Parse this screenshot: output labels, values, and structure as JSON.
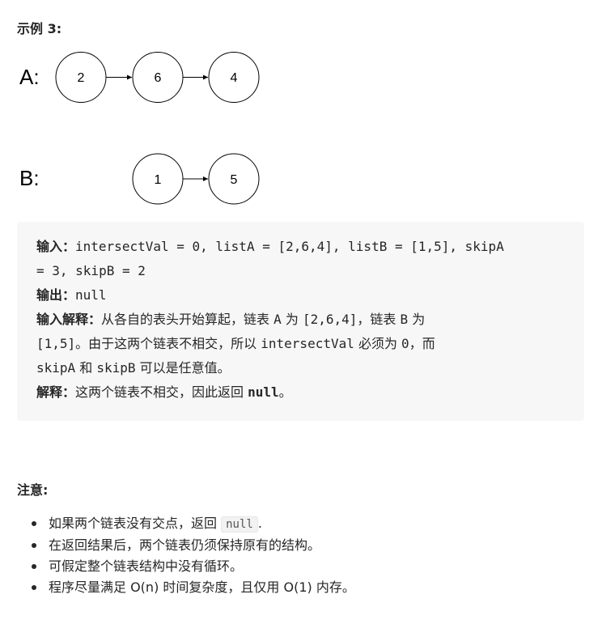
{
  "example_title": "示例 3:",
  "diagram": {
    "list_a_label": "A:",
    "list_a_nodes": [
      "2",
      "6",
      "4"
    ],
    "list_b_label": "B:",
    "list_b_nodes": [
      "1",
      "5"
    ]
  },
  "code": {
    "input_label": "输入：",
    "input_text_1": "intersectVal = 0, listA = [2,6,4], listB = [1,5], skipA",
    "input_text_2": "= 3, skipB = 2",
    "output_label": "输出：",
    "output_text": "null",
    "explain_label": "输入解释：",
    "explain_1a": "从各自的表头开始算起，链表 ",
    "explain_1b": "A",
    "explain_1c": " 为 ",
    "explain_1d": "[2,6,4]",
    "explain_1e": "，链表 ",
    "explain_1f": "B",
    "explain_1g": " 为",
    "explain_2a": "[1,5]",
    "explain_2b": "。由于这两个链表不相交，所以 ",
    "explain_2c": "intersectVal",
    "explain_2d": " 必须为 ",
    "explain_2e": "0",
    "explain_2f": "，而",
    "explain_3a": "skipA",
    "explain_3b": " 和 ",
    "explain_3c": "skipB",
    "explain_3d": " 可以是任意值。",
    "reason_label": "解释：",
    "reason_a": "这两个链表不相交，因此返回 ",
    "reason_b": "null",
    "reason_c": "。"
  },
  "notes": {
    "title": "注意:",
    "item1_text": "如果两个链表没有交点，返回 ",
    "item1_code": "null",
    "item1_end": ".",
    "item2": "在返回结果后，两个链表仍须保持原有的结构。",
    "item3": "可假定整个链表结构中没有循环。",
    "item4": "程序尽量满足 O(n) 时间复杂度，且仅用 O(1) 内存。"
  }
}
